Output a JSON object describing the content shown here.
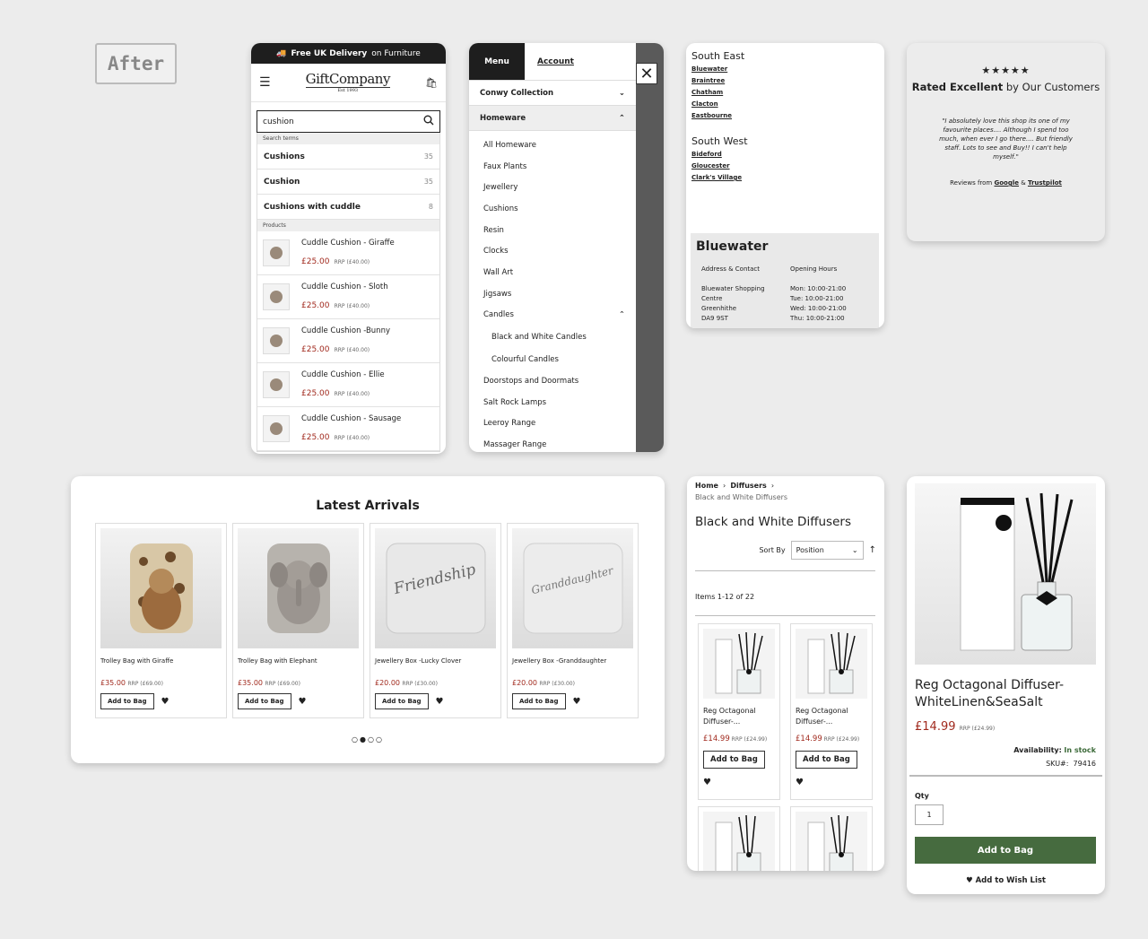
{
  "badge": "After",
  "search_card": {
    "delivery_bold": "Free UK Delivery",
    "delivery_rest": "on Furniture",
    "logo": "GiftCompany",
    "logo_est": "Est 1993",
    "search_value": "cushion",
    "terms_header": "Search terms",
    "terms": [
      {
        "label": "Cushions",
        "count": "35"
      },
      {
        "label": "Cushion",
        "count": "35"
      },
      {
        "label": "Cushions with cuddle",
        "count": "8"
      }
    ],
    "products_header": "Products",
    "products": [
      {
        "name": "Cuddle Cushion - Giraffe",
        "price": "£25.00",
        "rrp": "RRP (£40.00)"
      },
      {
        "name": "Cuddle Cushion - Sloth",
        "price": "£25.00",
        "rrp": "RRP (£40.00)"
      },
      {
        "name": "Cuddle Cushion -Bunny",
        "price": "£25.00",
        "rrp": "RRP (£40.00)"
      },
      {
        "name": "Cuddle Cushion - Ellie",
        "price": "£25.00",
        "rrp": "RRP (£40.00)"
      },
      {
        "name": "Cuddle Cushion - Sausage",
        "price": "£25.00",
        "rrp": "RRP (£40.00)"
      }
    ]
  },
  "menu_card": {
    "tab_menu": "Menu",
    "tab_account": "Account",
    "section1": "Conwy Collection",
    "section2": "Homeware",
    "items": [
      "All Homeware",
      "Faux Plants",
      "Jewellery",
      "Cushions",
      "Resin",
      "Clocks",
      "Wall Art",
      "Jigsaws",
      "Candles"
    ],
    "candle_subs": [
      "Black and White Candles",
      "Colourful Candles"
    ],
    "items_after": [
      "Doorstops and Doormats",
      "Salt Rock Lamps",
      "Leeroy Range",
      "Massager Range"
    ]
  },
  "stores_card": {
    "region1": "South East",
    "region1_stores": [
      "Bluewater",
      "Braintree",
      "Chatham",
      "Clacton",
      "Eastbourne"
    ],
    "region2": "South West",
    "region2_stores": [
      "Bideford",
      "Gloucester",
      "Clark's Village"
    ],
    "detail_title": "Bluewater",
    "address_head": "Address & Contact",
    "address_lines": [
      "Bluewater Shopping",
      "Centre",
      "Greenhithe",
      "DA9 9ST"
    ],
    "hours_head": "Opening Hours",
    "hours": [
      "Mon: 10:00-21:00",
      "Tue: 10:00-21:00",
      "Wed: 10:00-21:00",
      "Thu: 10:00-21:00"
    ]
  },
  "reviews_card": {
    "stars": "★★★★★",
    "rated_bold": "Rated Excellent",
    "rated_rest": "by Our Customers",
    "quote": "\"I absolutely love this shop its one of my favourite places.... Although I spend too much, when ever I go there.... But friendly staff. Lots to see and Buy!! I can't help myself.\"",
    "reviews_from": "Reviews from",
    "google": "Google",
    "amp": "&",
    "trustpilot": "Trustpilot"
  },
  "arrivals_card": {
    "title": "Latest Arrivals",
    "add_label": "Add to Bag",
    "items": [
      {
        "name": "Trolley Bag with Giraffe",
        "price": "£35.00",
        "rrp": "RRP (£69.00)"
      },
      {
        "name": "Trolley Bag with Elephant",
        "price": "£35.00",
        "rrp": "RRP (£69.00)"
      },
      {
        "name": "Jewellery Box -Lucky Clover",
        "price": "£20.00",
        "rrp": "RRP (£30.00)"
      },
      {
        "name": "Jewellery Box -Granddaughter",
        "price": "£20.00",
        "rrp": "RRP (£30.00)"
      }
    ],
    "box_text_1": "Friendship",
    "box_text_2": "Granddaughter"
  },
  "listing_card": {
    "crumb_home": "Home",
    "crumb_sep": "›",
    "crumb_diffusers": "Diffusers",
    "crumb_current": "Black and White Diffusers",
    "title": "Black and White Diffusers",
    "sort_label": "Sort By",
    "sort_value": "Position",
    "items_count": "Items 1-12 of 22",
    "add_label": "Add to Bag",
    "products": [
      {
        "name": "Reg Octagonal Diffuser-...",
        "price": "£14.99",
        "rrp": "RRP (£24.99)"
      },
      {
        "name": "Reg Octagonal Diffuser-...",
        "price": "£14.99",
        "rrp": "RRP (£24.99)"
      }
    ]
  },
  "product_card": {
    "title": "Reg Octagonal Diffuser-WhiteLinen&SeaSalt",
    "price": "£14.99",
    "rrp": "RRP (£24.99)",
    "availability_label": "Availability:",
    "availability_value": "In stock",
    "sku_label": "SKU#:",
    "sku_value": "79416",
    "qty_label": "Qty",
    "qty_value": "1",
    "add_label": "Add to Bag",
    "wish_label": "Add to Wish List"
  }
}
